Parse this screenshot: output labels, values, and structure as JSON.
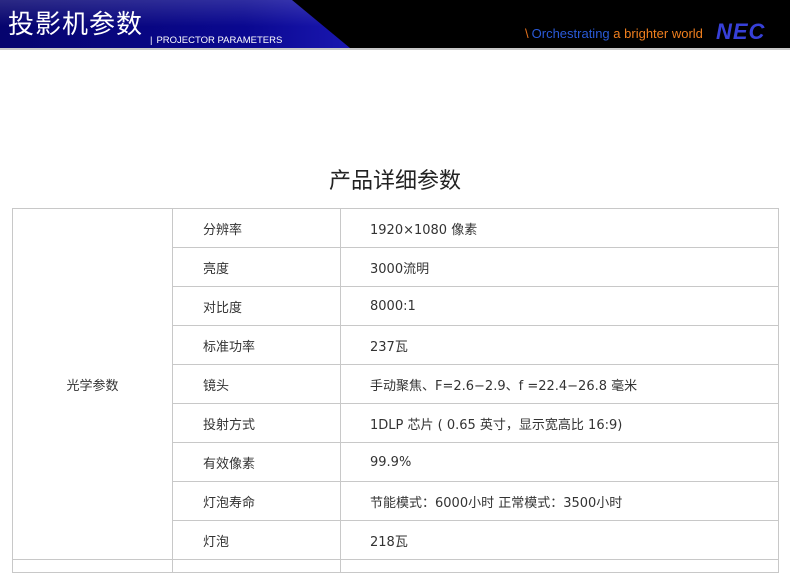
{
  "header": {
    "title_cn": "投影机参数",
    "title_separator": "|",
    "title_en": "PROJECTOR PARAMETERS",
    "tagline_slash": "\\",
    "tagline_part1": "Orchestrating",
    "tagline_part2": "a brighter world",
    "logo": "NEC"
  },
  "heading": "产品详细参数",
  "spec_table": {
    "group_label": "光学参数",
    "rows": [
      {
        "param": "分辨率",
        "value": "1920×1080 像素"
      },
      {
        "param": "亮度",
        "value": "3000流明"
      },
      {
        "param": "对比度",
        "value": "8000:1"
      },
      {
        "param": "标准功率",
        "value": "237瓦"
      },
      {
        "param": "镜头",
        "value": "手动聚焦、F=2.6−2.9、f =22.4−26.8 毫米"
      },
      {
        "param": "投射方式",
        "value": "1DLP 芯片 ( 0.65 英寸，显示宽高比 16:9)"
      },
      {
        "param": "有效像素",
        "value": "99.9%"
      },
      {
        "param": "灯泡寿命",
        "value": "节能模式：6000小时   正常模式：3500小时"
      },
      {
        "param": "灯泡",
        "value": "218瓦"
      }
    ]
  },
  "colors": {
    "banner_black": "#000000",
    "banner_blue": "#0a0890",
    "tagline_blue": "#2a5ad8",
    "tagline_orange": "#f07f1e",
    "logo_blue": "#3740d8",
    "table_border": "#c8c8c8"
  }
}
